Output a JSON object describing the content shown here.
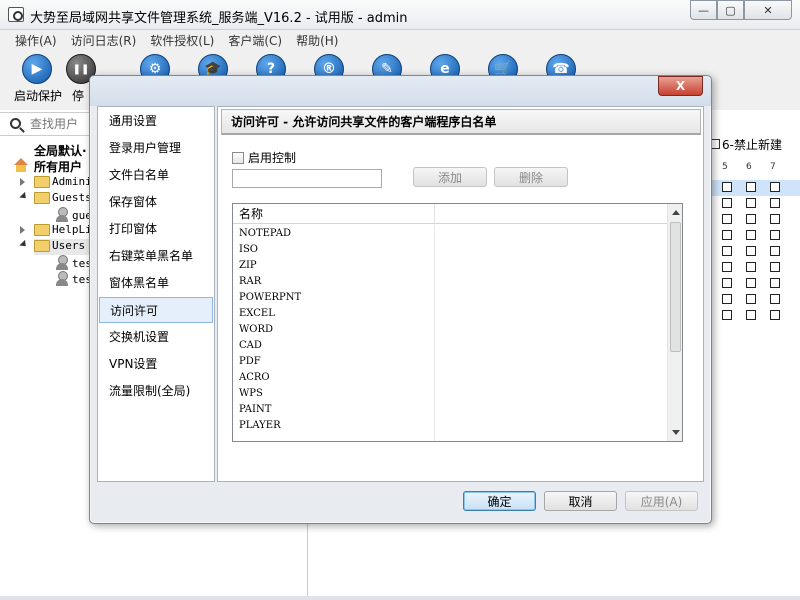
{
  "window": {
    "title": "大势至局域网共享文件管理系统_服务端_V16.2 - 试用版 - admin"
  },
  "menu": [
    "操作(A)",
    "访问日志(R)",
    "软件授权(L)",
    "客户端(C)",
    "帮助(H)"
  ],
  "toolbar": [
    {
      "label": "启动保护",
      "icon": "play-icon",
      "glyph": "▶"
    },
    {
      "label": "停",
      "icon": "pause-icon",
      "glyph": "❚❚"
    }
  ],
  "toolbar_icons": [
    {
      "icon": "gear-icon",
      "glyph": "⚙"
    },
    {
      "icon": "graduation-cap-icon",
      "glyph": "🎓"
    },
    {
      "icon": "help-icon",
      "glyph": "?"
    },
    {
      "icon": "registered-icon",
      "glyph": "®"
    },
    {
      "icon": "document-edit-icon",
      "glyph": "✎"
    },
    {
      "icon": "browser-icon",
      "glyph": "e"
    },
    {
      "icon": "cart-icon",
      "glyph": "🛒"
    },
    {
      "icon": "phone-icon",
      "glyph": "☎"
    }
  ],
  "search": {
    "placeholder": "查找用户"
  },
  "tree": {
    "root1": "全局默认·",
    "root2": "所有用户",
    "groups": [
      {
        "label": "Admini",
        "expanded": false
      },
      {
        "label": "Guests",
        "expanded": true,
        "children": [
          "gue"
        ]
      },
      {
        "label": "HelpLi",
        "expanded": false
      },
      {
        "label": "Users",
        "expanded": true,
        "children": [
          "tes",
          "tes"
        ]
      }
    ]
  },
  "right_pane": {
    "header": "6-禁止新建",
    "column_numbers": [
      "5",
      "6",
      "7"
    ]
  },
  "dialog": {
    "close_label": "X",
    "nav_items": [
      "通用设置",
      "登录用户管理",
      "文件白名单",
      "保存窗体",
      "打印窗体",
      "右键菜单黑名单",
      "窗体黑名单",
      "访问许可",
      "交换机设置",
      "VPN设置",
      "流量限制(全局)"
    ],
    "selected_nav_index": 7,
    "content_title": "访问许可 - 允许访问共享文件的客户端程序白名单",
    "enable_control_label": "启用控制",
    "enable_control_checked": false,
    "add_label": "添加",
    "delete_label": "删除",
    "list_header": "名称",
    "list_items": [
      "NOTEPAD",
      "ISO",
      "ZIP",
      "RAR",
      "POWERPNT",
      "EXCEL",
      "WORD",
      "CAD",
      "PDF",
      "ACRO",
      "WPS",
      "PAINT",
      "PLAYER"
    ],
    "ok_label": "确定",
    "cancel_label": "取消",
    "apply_label": "应用(A)"
  }
}
